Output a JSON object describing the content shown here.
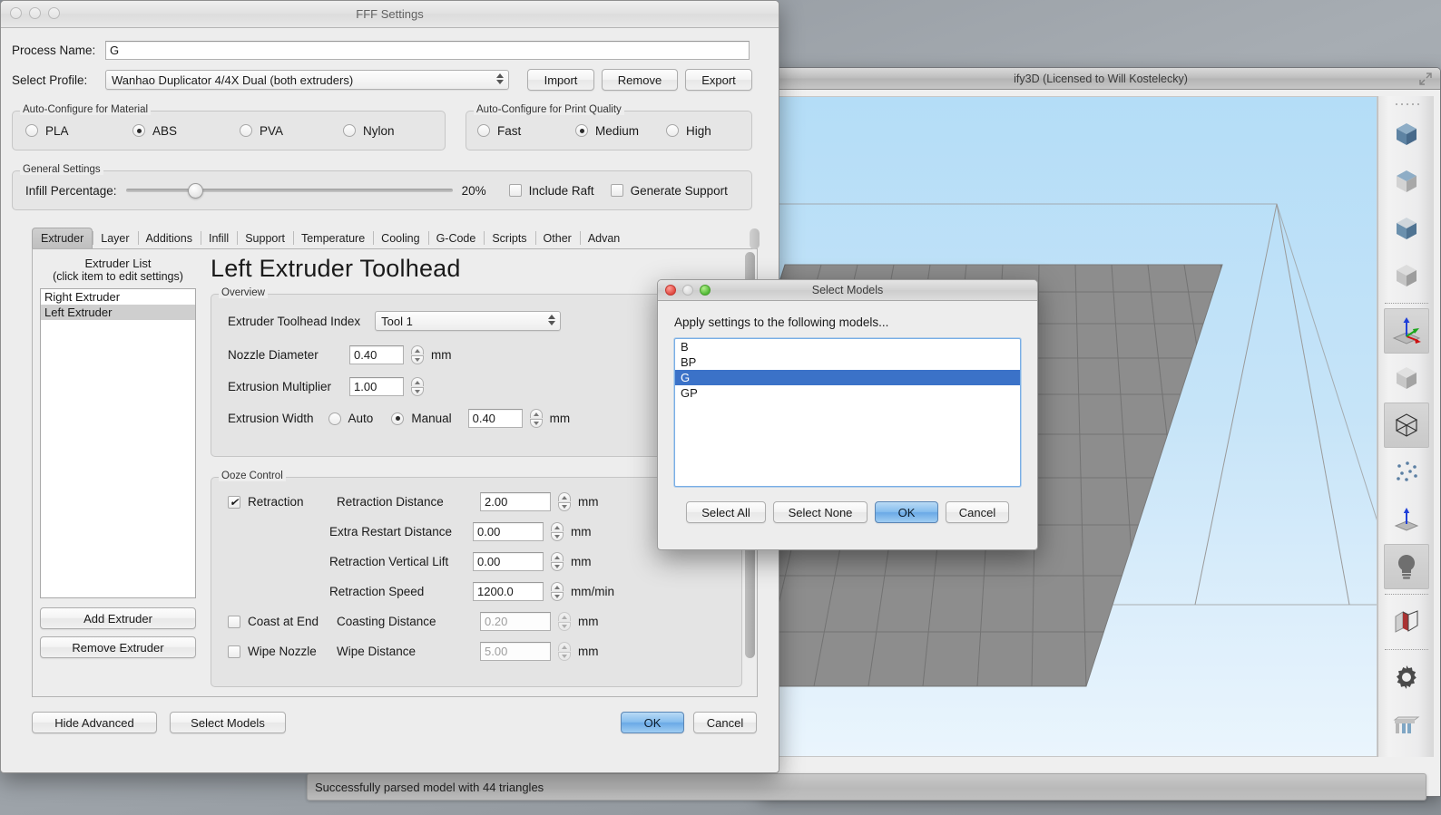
{
  "desktop": {
    "status_bar_text": "Successfully parsed model with 44 triangles"
  },
  "s3d_window": {
    "title": "ify3D (Licensed to Will Kostelecky)",
    "expand_icon": "expand-icon",
    "toolbar": [
      {
        "name": "view-cube-blue-1",
        "icon": "cube-blue-icon"
      },
      {
        "name": "view-cube-gray-1",
        "icon": "cube-gray-icon"
      },
      {
        "name": "view-cube-blue-2",
        "icon": "cube-blue-icon"
      },
      {
        "name": "view-cube-gray-2",
        "icon": "cube-gray-icon"
      },
      {
        "name": "axis-gizmo",
        "icon": "axes-icon",
        "active": true
      },
      {
        "name": "solid-view",
        "icon": "cube-solid-icon"
      },
      {
        "name": "wireframe-view",
        "icon": "cube-wireframe-icon",
        "active": true
      },
      {
        "name": "point-cloud-view",
        "icon": "points-icon"
      },
      {
        "name": "normals-view",
        "icon": "normal-arrow-icon"
      },
      {
        "name": "lighting-toggle",
        "icon": "lightbulb-icon",
        "active": true
      },
      {
        "name": "cross-section",
        "icon": "cross-section-icon"
      },
      {
        "name": "settings",
        "icon": "gear-icon"
      },
      {
        "name": "supports",
        "icon": "support-structure-icon"
      }
    ]
  },
  "fff": {
    "title": "FFF Settings",
    "process_name_label": "Process Name:",
    "process_name_value": "G",
    "select_profile_label": "Select Profile:",
    "select_profile_value": "Wanhao Duplicator 4/4X Dual (both extruders)",
    "import_label": "Import",
    "remove_label": "Remove",
    "export_label": "Export",
    "material_group_title": "Auto-Configure for Material",
    "materials": [
      {
        "label": "PLA",
        "selected": false
      },
      {
        "label": "ABS",
        "selected": true
      },
      {
        "label": "PVA",
        "selected": false
      },
      {
        "label": "Nylon",
        "selected": false
      }
    ],
    "quality_group_title": "Auto-Configure for Print Quality",
    "qualities": [
      {
        "label": "Fast",
        "selected": false
      },
      {
        "label": "Medium",
        "selected": true
      },
      {
        "label": "High",
        "selected": false
      }
    ],
    "general_group_title": "General Settings",
    "infill_label": "Infill Percentage:",
    "infill_value": "20%",
    "infill_percent": 20,
    "include_raft_label": "Include Raft",
    "include_raft_checked": false,
    "generate_support_label": "Generate Support",
    "generate_support_checked": false,
    "tabs": [
      {
        "label": "Extruder",
        "active": true
      },
      {
        "label": "Layer",
        "active": false
      },
      {
        "label": "Additions",
        "active": false
      },
      {
        "label": "Infill",
        "active": false
      },
      {
        "label": "Support",
        "active": false
      },
      {
        "label": "Temperature",
        "active": false
      },
      {
        "label": "Cooling",
        "active": false
      },
      {
        "label": "G-Code",
        "active": false
      },
      {
        "label": "Scripts",
        "active": false
      },
      {
        "label": "Other",
        "active": false
      },
      {
        "label": "Advan",
        "active": false
      }
    ],
    "extruder_list_title": "Extruder List",
    "extruder_list_subtitle": "(click item to edit settings)",
    "extruder_list": [
      {
        "label": "Right Extruder",
        "selected": false
      },
      {
        "label": "Left Extruder",
        "selected": true
      }
    ],
    "add_extruder_label": "Add Extruder",
    "remove_extruder_label": "Remove Extruder",
    "panel_heading": "Left Extruder Toolhead",
    "overview_group_title": "Overview",
    "overview": {
      "toolhead_index_label": "Extruder Toolhead Index",
      "toolhead_index_value": "Tool 1",
      "nozzle_diameter_label": "Nozzle Diameter",
      "nozzle_diameter_value": "0.40",
      "nozzle_diameter_unit": "mm",
      "extrusion_multiplier_label": "Extrusion Multiplier",
      "extrusion_multiplier_value": "1.00",
      "extrusion_width_label": "Extrusion Width",
      "extrusion_width_auto_label": "Auto",
      "extrusion_width_manual_label": "Manual",
      "extrusion_width_mode": "Manual",
      "extrusion_width_value": "0.40",
      "extrusion_width_unit": "mm"
    },
    "ooze_group_title": "Ooze Control",
    "ooze": {
      "retraction_label": "Retraction",
      "retraction_checked": true,
      "retraction_distance_label": "Retraction Distance",
      "retraction_distance_value": "2.00",
      "retraction_distance_unit": "mm",
      "extra_restart_label": "Extra Restart Distance",
      "extra_restart_value": "0.00",
      "extra_restart_unit": "mm",
      "vertical_lift_label": "Retraction Vertical Lift",
      "vertical_lift_value": "0.00",
      "vertical_lift_unit": "mm",
      "retraction_speed_label": "Retraction Speed",
      "retraction_speed_value": "1200.0",
      "retraction_speed_unit": "mm/min",
      "coast_label": "Coast at End",
      "coast_checked": false,
      "coasting_distance_label": "Coasting Distance",
      "coasting_distance_value": "0.20",
      "coasting_distance_unit": "mm",
      "wipe_label": "Wipe Nozzle",
      "wipe_checked": false,
      "wipe_distance_label": "Wipe Distance",
      "wipe_distance_value": "5.00",
      "wipe_distance_unit": "mm"
    },
    "hide_advanced_label": "Hide Advanced",
    "select_models_label": "Select Models",
    "ok_label": "OK",
    "cancel_label": "Cancel"
  },
  "select_models": {
    "title": "Select Models",
    "prompt": "Apply settings to the following models...",
    "items": [
      {
        "label": "B",
        "selected": false
      },
      {
        "label": "BP",
        "selected": false
      },
      {
        "label": "G",
        "selected": true
      },
      {
        "label": "GP",
        "selected": false
      }
    ],
    "select_all_label": "Select All",
    "select_none_label": "Select None",
    "ok_label": "OK",
    "cancel_label": "Cancel"
  },
  "colors": {
    "selection_blue": "#3b72c8",
    "default_button_blue": "#6aa9e6",
    "model_orange": "#f08a1e",
    "model_yellow": "#e8c51c",
    "viewport_sky": "#b4ddf7"
  }
}
